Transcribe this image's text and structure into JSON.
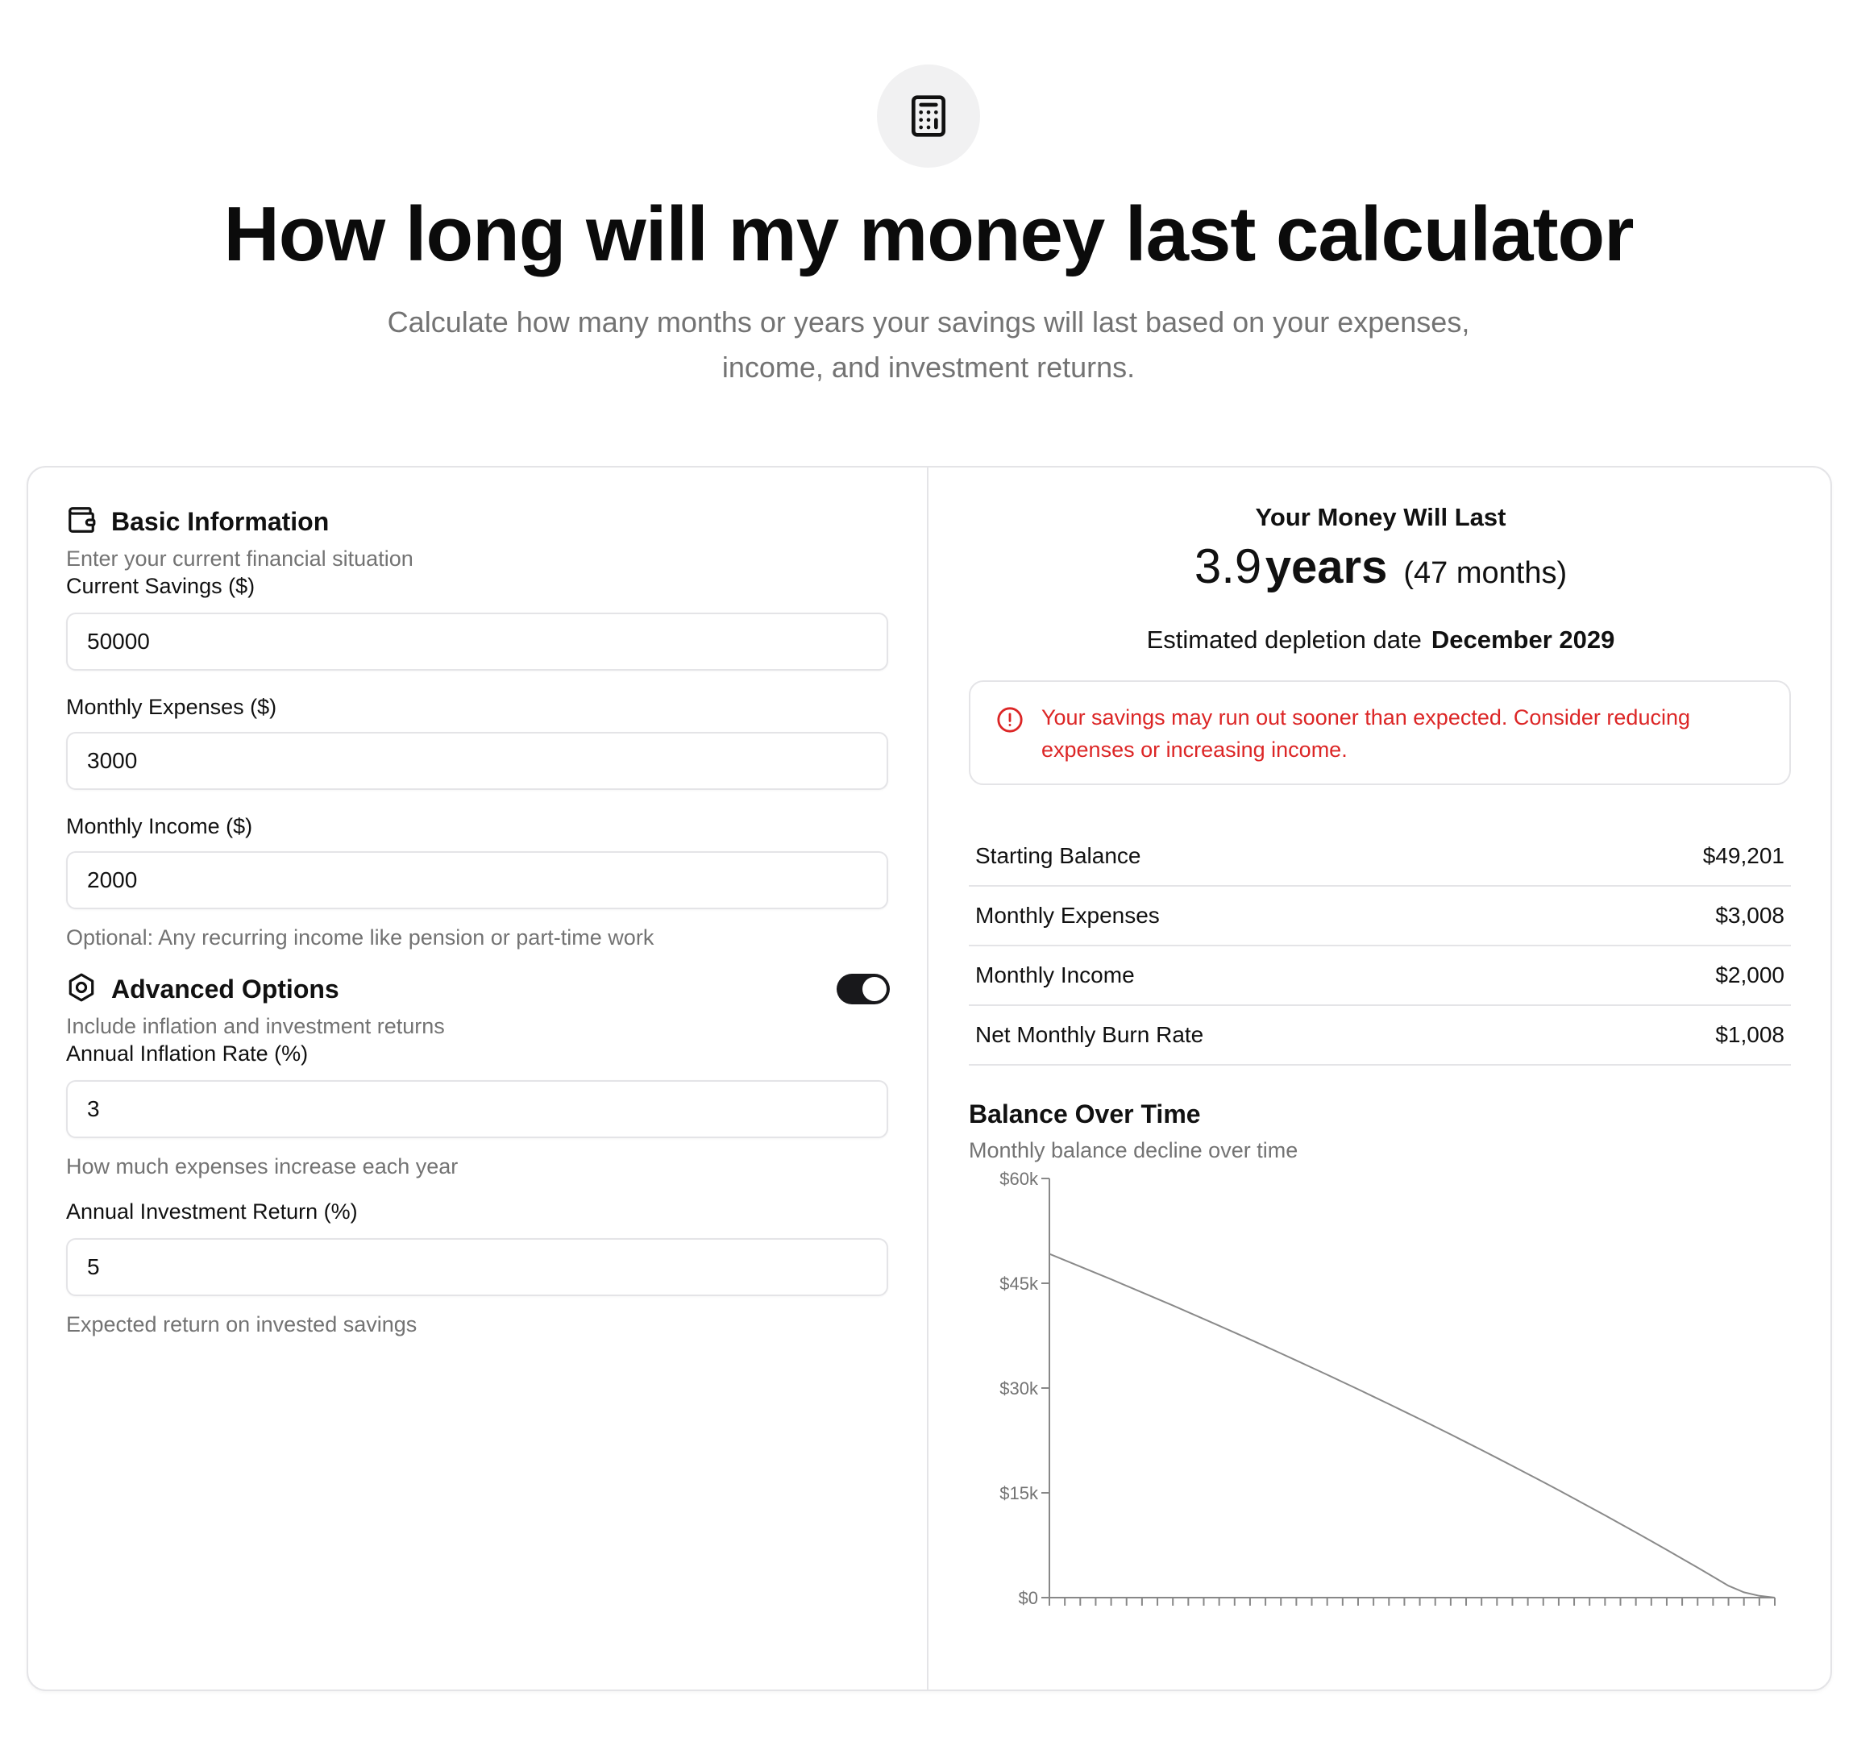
{
  "header": {
    "icon": "calculator-icon",
    "title": "How long will my money last calculator",
    "subtitle_line1": "Calculate how many months or years your savings will last based on your expenses,",
    "subtitle_line2": "income, and investment returns."
  },
  "basic": {
    "icon": "wallet-icon",
    "title": "Basic Information",
    "description": "Enter your current financial situation",
    "current_savings_label": "Current Savings ($)",
    "current_savings_value": "50000",
    "monthly_expenses_label": "Monthly Expenses ($)",
    "monthly_expenses_value": "3000",
    "monthly_income_label": "Monthly Income ($)",
    "monthly_income_value": "2000",
    "monthly_income_help": "Optional: Any recurring income like pension or part-time work"
  },
  "advanced": {
    "icon": "hexagon-settings-icon",
    "title": "Advanced Options",
    "description": "Include inflation and investment returns",
    "enabled": true,
    "inflation_label": "Annual Inflation Rate (%)",
    "inflation_value": "3",
    "inflation_help": "How much expenses increase each year",
    "return_label": "Annual Investment Return (%)",
    "return_value": "5",
    "return_help": "Expected return on invested savings"
  },
  "results": {
    "heading": "Your Money Will Last",
    "years_number": "3.9",
    "years_unit": "years",
    "months": "(47 months)",
    "depletion_label": "Estimated depletion date",
    "depletion_date": "December 2029",
    "alert_icon": "alert-circle-icon",
    "alert_text": "Your savings may run out sooner than expected. Consider reducing expenses or increasing income.",
    "alert_color": "#dc2626",
    "summary": [
      {
        "label": "Starting Balance",
        "value": "$49,201"
      },
      {
        "label": "Monthly Expenses",
        "value": "$3,008"
      },
      {
        "label": "Monthly Income",
        "value": "$2,000"
      },
      {
        "label": "Net Monthly Burn Rate",
        "value": "$1,008"
      }
    ]
  },
  "chart": {
    "title": "Balance Over Time",
    "subtitle": "Monthly balance decline over time"
  },
  "chart_data": {
    "type": "line",
    "title": "Balance Over Time",
    "xlabel": "",
    "ylabel": "",
    "ylim": [
      0,
      60000
    ],
    "y_ticks": [
      "$0",
      "$15k",
      "$30k",
      "$45k",
      "$60k"
    ],
    "grid": false,
    "series": [
      {
        "values": [
          49201,
          48300,
          47393,
          46480,
          45560,
          44633,
          43699,
          42758,
          41810,
          40855,
          39892,
          38922,
          37944,
          36958,
          35964,
          34962,
          33951,
          32932,
          31905,
          30869,
          29824,
          28770,
          27707,
          26635,
          25553,
          24462,
          23361,
          22250,
          21129,
          19998,
          18856,
          17704,
          16541,
          15367,
          14182,
          12986,
          11779,
          10560,
          9330,
          8088,
          6834,
          5568,
          4290,
          3000,
          1697,
          760,
          250,
          0
        ]
      }
    ],
    "line_color": "#8a8a8a"
  }
}
